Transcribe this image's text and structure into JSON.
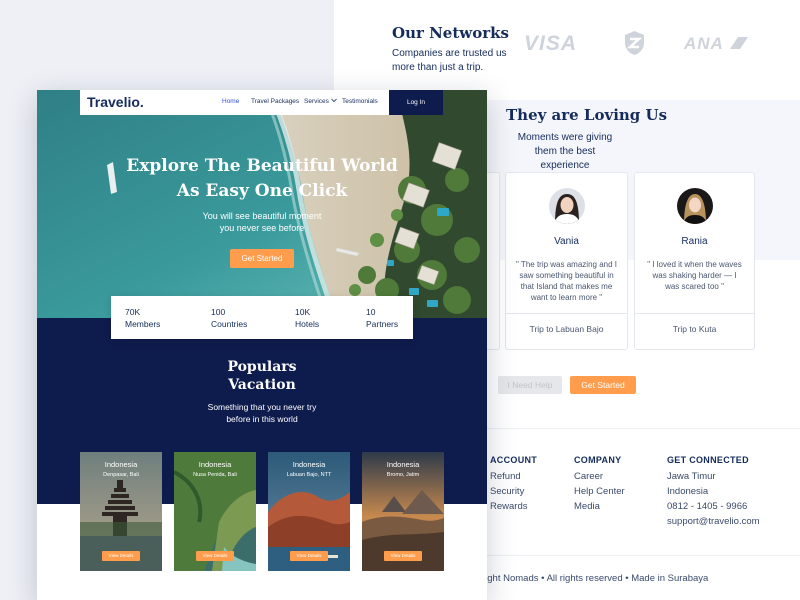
{
  "networks": {
    "title": "Our Networks",
    "subtitle": "Companies are trusted us more than just a trip.",
    "logos": [
      {
        "name": "VISA",
        "icon": "visa-logo"
      },
      {
        "name": "shield",
        "icon": "shield-logo"
      },
      {
        "name": "ANA",
        "icon": "ana-logo"
      }
    ]
  },
  "testimonials": {
    "title": "They are Loving Us",
    "subtitle": "Moments were giving them the best experience",
    "items": [
      {
        "name": "Vania",
        "quote": "\" The trip was amazing and I saw something beautiful in that Island that makes me want to learn more \"",
        "trip": "Trip to Labuan Bajo"
      },
      {
        "name": "Rania",
        "quote": "\" I loved it when the waves was shaking harder — I was scared too \"",
        "trip": "Trip to Kuta"
      }
    ],
    "need_help": "I Need Help",
    "get_started": "Get Started"
  },
  "footer": {
    "columns": [
      {
        "heading": "ACCOUNT",
        "links": [
          "Refund",
          "Security",
          "Rewards"
        ]
      },
      {
        "heading": "COMPANY",
        "links": [
          "Career",
          "Help  Center",
          "Media"
        ]
      },
      {
        "heading": "GET CONNECTED",
        "links": [
          "Jawa Timur",
          "Indonesia",
          "0812 - 1405 - 9966",
          "support@travelio.com"
        ]
      }
    ],
    "copyright": "right Nomads • All rights reserved • Made in Surabaya"
  },
  "nav": {
    "brand": "Travelio",
    "brand_dot": ".",
    "links": [
      "Home",
      "Travel Packages",
      "Services",
      "Testimonials"
    ],
    "active": "Home",
    "login": "Log In"
  },
  "hero": {
    "title_line1": "Explore The Beautiful World",
    "title_line2": "As Easy One Click",
    "subtitle_line1": "You will see beautiful moment",
    "subtitle_line2": "you never see before",
    "cta": "Get Started"
  },
  "stats": [
    {
      "value": "70K",
      "label": "Members"
    },
    {
      "value": "100",
      "label": "Countries"
    },
    {
      "value": "10K",
      "label": "Hotels"
    },
    {
      "value": "10",
      "label": "Partners"
    }
  ],
  "popular": {
    "title_line1": "Populars",
    "title_line2": "Vacation",
    "subtitle_line1": "Something that you never try",
    "subtitle_line2": "before in this world",
    "cards": [
      {
        "country": "Indonesia",
        "place": "Denpasar, Bali",
        "button": "View Details"
      },
      {
        "country": "Indonesia",
        "place": "Nusa Penida, Bali",
        "button": "View Details"
      },
      {
        "country": "Indonesia",
        "place": "Labuan Bajo, NTT",
        "button": "View Details"
      },
      {
        "country": "Indonesia",
        "place": "Bromo, Jatim",
        "button": "View Details"
      }
    ]
  },
  "colors": {
    "navy": "#0e1b4d",
    "text": "#152c5b",
    "accent": "#ff9d4d",
    "nav_active": "#3252df",
    "background": "#eef0f6"
  }
}
